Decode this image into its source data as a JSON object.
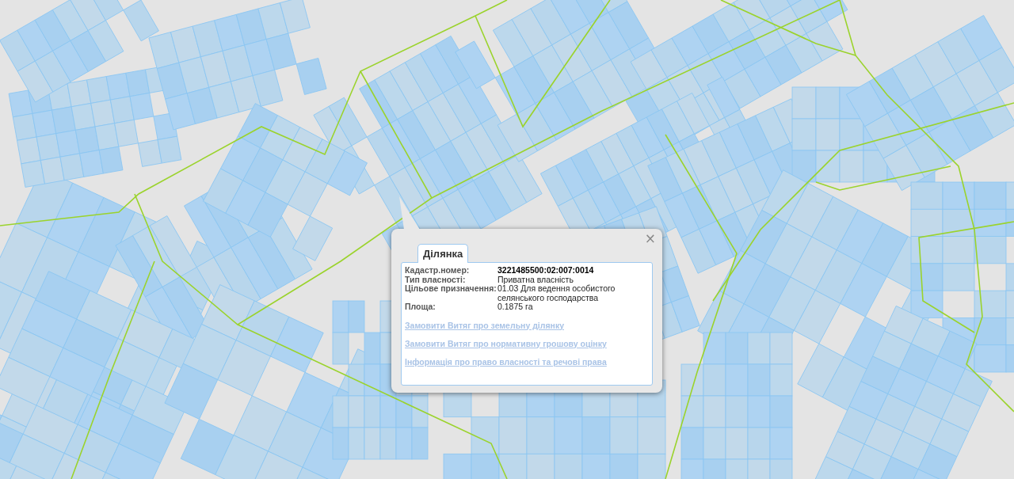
{
  "popup": {
    "tab": {
      "label": "Ділянка",
      "selected": true
    },
    "close": "×",
    "fields": [
      {
        "label": "Кадастр.номер:",
        "value": "3221485500:02:007:0014",
        "kind": "bold"
      },
      {
        "label": "Тип власності:",
        "value": "Приватна власність",
        "kind": "plain"
      },
      {
        "label": "Цільове призначення:",
        "value": "01.03 Для ведення особистого селянського господарства",
        "kind": "plain"
      },
      {
        "label": "Площа:",
        "value": "0.1875 га",
        "kind": "plain"
      }
    ],
    "links": [
      "Замовити Витяг про земельну ділянку",
      "Замовити Витяг про нормативну грошову оцінку",
      "Інформація про право власності та речові права"
    ]
  }
}
